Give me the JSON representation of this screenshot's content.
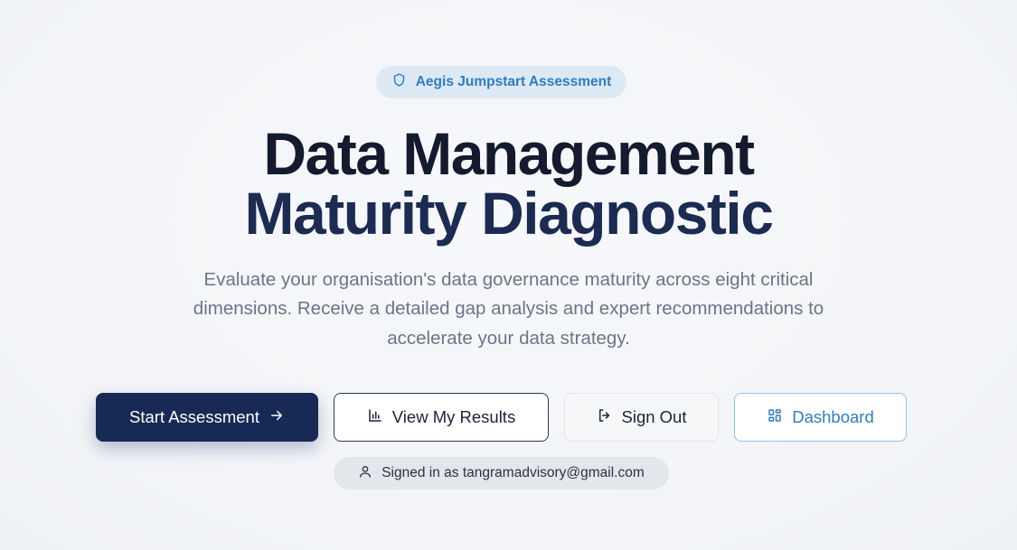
{
  "badge": {
    "label": "Aegis Jumpstart Assessment",
    "icon": "shield-icon"
  },
  "hero": {
    "title_line1": "Data Management",
    "title_line2": "Maturity Diagnostic",
    "subtitle_lines": [
      "Evaluate your organisation's data governance maturity across eight critical",
      "dimensions. Receive a detailed gap analysis and expert recommendations to",
      "accelerate your data strategy."
    ]
  },
  "actions": {
    "start": {
      "label": "Start Assessment",
      "icon": "arrow-right-icon"
    },
    "results": {
      "label": "View My Results",
      "icon": "bar-chart-icon"
    },
    "signout": {
      "label": "Sign Out",
      "icon": "log-out-icon"
    },
    "dashboard": {
      "label": "Dashboard",
      "icon": "grid-icon"
    }
  },
  "user": {
    "label": "Signed in as tangramadvisory@gmail.com",
    "icon": "user-icon"
  },
  "colors": {
    "primary": "#172a55",
    "accent": "#2f7cc0",
    "title": "#141b2e",
    "muted": "#6b7587"
  }
}
